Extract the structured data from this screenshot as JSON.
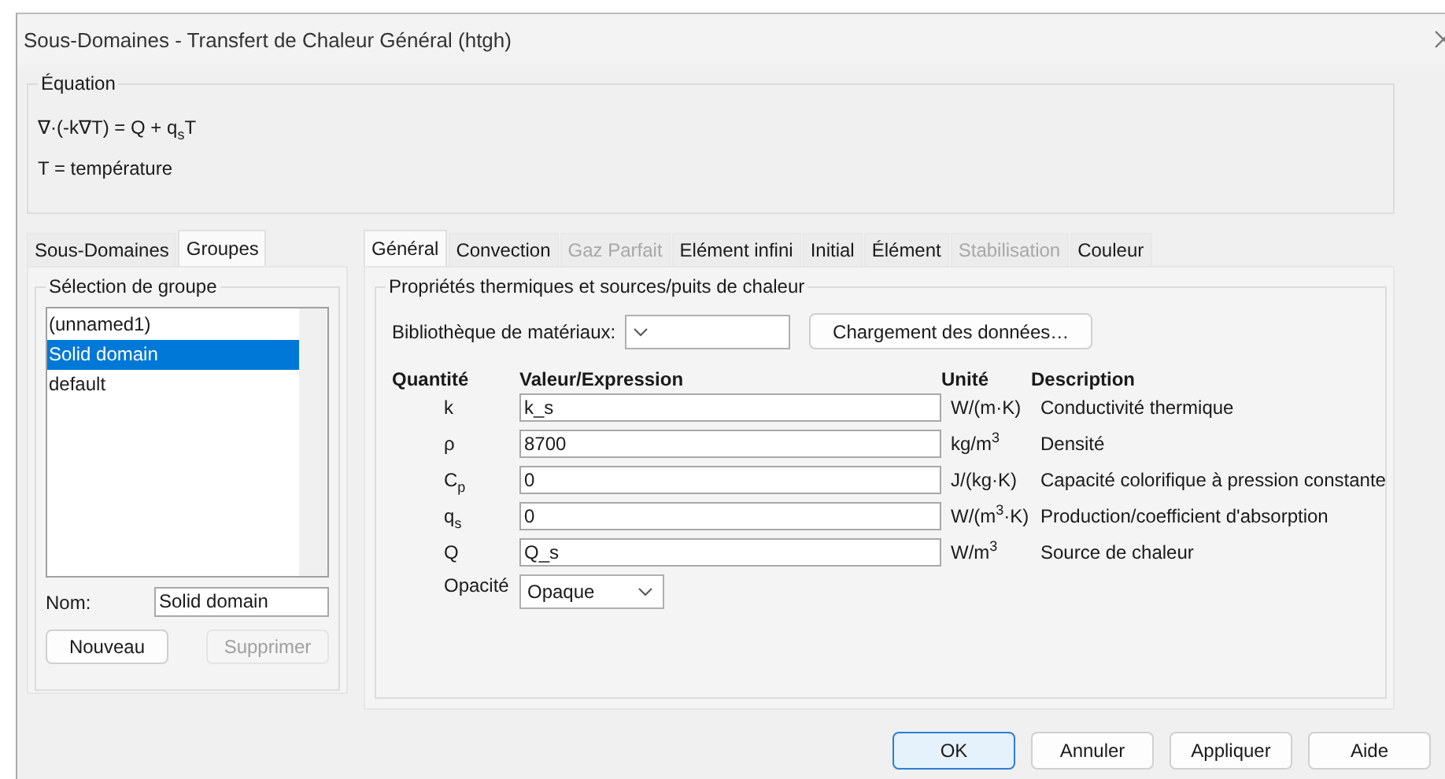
{
  "window": {
    "title": "Sous-Domaines - Transfert de Chaleur Général (htgh)"
  },
  "equation": {
    "label": "Équation",
    "formula": "∇·(-k∇T) = Q + q$_{s}$T",
    "definition": "T = température"
  },
  "left_tabs": [
    {
      "label": "Sous-Domaines",
      "selected": false
    },
    {
      "label": "Groupes",
      "selected": true
    }
  ],
  "group_selection": {
    "label": "Sélection de groupe",
    "items": [
      {
        "label": "(unnamed1)",
        "selected": false
      },
      {
        "label": "Solid domain",
        "selected": true
      },
      {
        "label": "default",
        "selected": false
      }
    ],
    "name_label": "Nom:",
    "name_value": "Solid domain",
    "buttons": [
      {
        "label": "Nouveau",
        "disabled": false
      },
      {
        "label": "Supprimer",
        "disabled": true
      }
    ]
  },
  "right_tabs": [
    {
      "label": "Général",
      "selected": true,
      "disabled": false
    },
    {
      "label": "Convection",
      "selected": false,
      "disabled": false
    },
    {
      "label": "Gaz Parfait",
      "selected": false,
      "disabled": true
    },
    {
      "label": "Elément infini",
      "selected": false,
      "disabled": false
    },
    {
      "label": "Initial",
      "selected": false,
      "disabled": false
    },
    {
      "label": "Élément",
      "selected": false,
      "disabled": false
    },
    {
      "label": "Stabilisation",
      "selected": false,
      "disabled": true
    },
    {
      "label": "Couleur",
      "selected": false,
      "disabled": false
    }
  ],
  "properties": {
    "title": "Propriétés thermiques et sources/puits de chaleur",
    "library_label": "Bibliothèque de matériaux:",
    "load_button": "Chargement des données…",
    "columns": [
      "Quantité",
      "Valeur/Expression",
      "Unité",
      "Description"
    ],
    "rows": [
      {
        "quantity": "k",
        "value": "k_s",
        "unit": "W/(m·K)",
        "description": "Conductivité thermique"
      },
      {
        "quantity": "ρ",
        "value": "8700",
        "unit": "kg/m$^{3}$",
        "description": "Densité"
      },
      {
        "quantity": "C$_{p}$",
        "value": "0",
        "unit": "J/(kg·K)",
        "description": "Capacité colorifique à pression constante"
      },
      {
        "quantity": "q$_{s}$",
        "value": "0",
        "unit": "W/(m$^{3}$·K)",
        "description": "Production/coefficient d'absorption"
      },
      {
        "quantity": "Q",
        "value": "Q_s",
        "unit": "W/m$^{3}$",
        "description": "Source de chaleur"
      }
    ],
    "opacity_label": "Opacité",
    "opacity_value": "Opaque"
  },
  "buttons": [
    {
      "label": "OK",
      "default": true
    },
    {
      "label": "Annuler",
      "default": false
    },
    {
      "label": "Appliquer",
      "default": false
    },
    {
      "label": "Aide",
      "default": false
    }
  ]
}
